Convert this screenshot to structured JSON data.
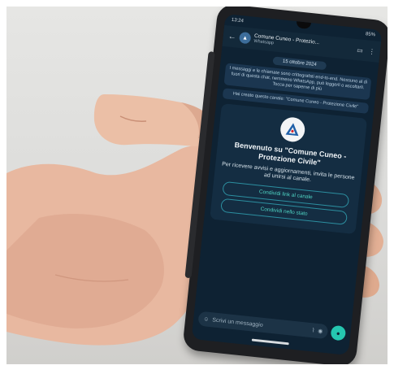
{
  "status_bar": {
    "time": "13:24",
    "battery": "85%"
  },
  "chat_header": {
    "title": "Comune Cuneo - Protezio...",
    "subtitle": "Whatsapp"
  },
  "date_chip": "15 ottobre 2024",
  "system_messages": [
    "I messaggi e le chiamate sono crittografati end-to-end. Nessuno al di fuori di questa chat, nemmeno WhatsApp, può leggerli o ascoltarli. Tocca per saperne di più",
    "Hai creato questo canale: \"Comune Cuneo - Protezione Civile\""
  ],
  "welcome_card": {
    "heading": "Benvenuto su \"Comune Cuneo - Protezione Civile\"",
    "description": "Per ricevere avvisi e aggiornamenti, invita le persone ad unirsi al canale.",
    "actions": [
      "Condividi link al canale",
      "Condividi nello stato"
    ]
  },
  "composer": {
    "placeholder": "Scrivi un messaggio"
  },
  "icons": {
    "back": "back-arrow-icon",
    "avatar": "channel-avatar-icon",
    "video": "video-icon",
    "call": "phone-icon",
    "menu": "more-vert-icon",
    "attach": "paperclip-icon",
    "camera": "camera-icon",
    "mic": "mic-icon"
  },
  "colors": {
    "screen_bg": "#0e2233",
    "accent": "#25c6b0",
    "card_bg": "#142d42"
  }
}
